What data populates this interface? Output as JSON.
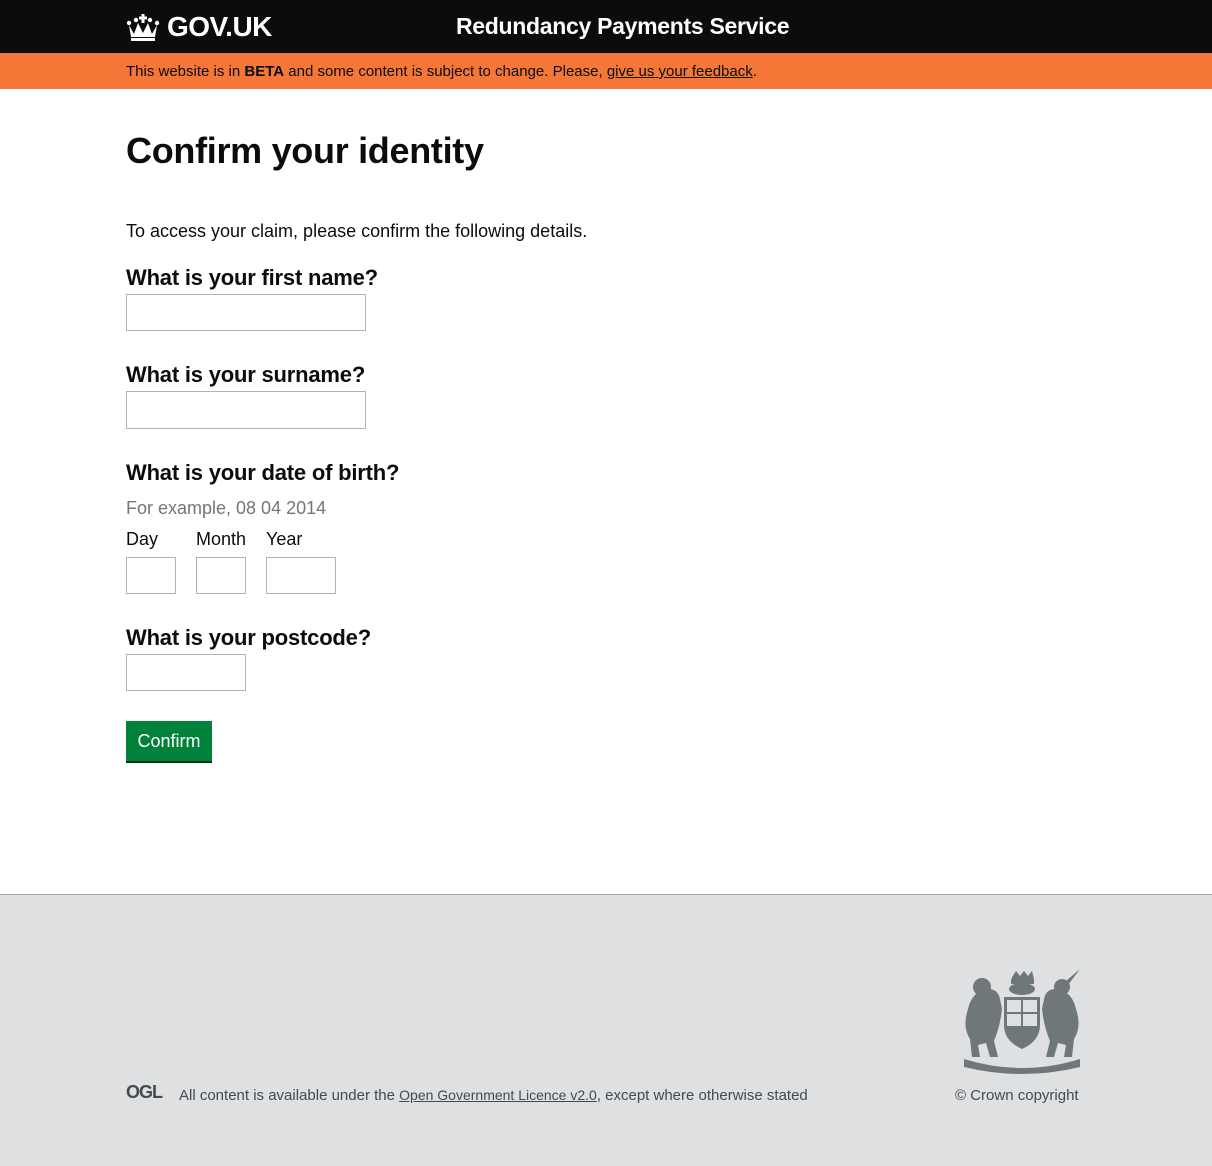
{
  "header": {
    "logo_text": "GOV.UK",
    "service_name": "Redundancy Payments Service"
  },
  "beta_banner": {
    "prefix": "This website is in ",
    "phase": "BETA",
    "middle": " and some content is subject to change. Please, ",
    "feedback_link": "give us your feedback",
    "suffix": "."
  },
  "main": {
    "title": "Confirm your identity",
    "intro": "To access your claim, please confirm the following details.",
    "first_name": {
      "question": "What is your first name?",
      "value": ""
    },
    "surname": {
      "question": "What is your surname?",
      "value": ""
    },
    "dob": {
      "question": "What is your date of birth?",
      "hint": "For example, 08 04 2014",
      "day_label": "Day",
      "month_label": "Month",
      "year_label": "Year",
      "day_value": "",
      "month_value": "",
      "year_value": ""
    },
    "postcode": {
      "question": "What is your postcode?",
      "value": ""
    },
    "confirm_label": "Confirm"
  },
  "footer": {
    "ogl_label": "OGL",
    "licence_prefix": "All content is available under the ",
    "licence_link": "Open Government Licence v2.0",
    "licence_suffix": ", except where otherwise stated",
    "copyright": "© Crown copyright"
  },
  "colors": {
    "header_bg": "#0b0c0c",
    "beta_bg": "#f47738",
    "button_bg": "#00823b",
    "footer_bg": "#dee0e2",
    "hint_text": "#6f777b"
  },
  "icons": {
    "logo": "crown-icon",
    "footer_licence": "ogl-logo-icon",
    "footer_crest": "royal-coat-of-arms-icon"
  }
}
